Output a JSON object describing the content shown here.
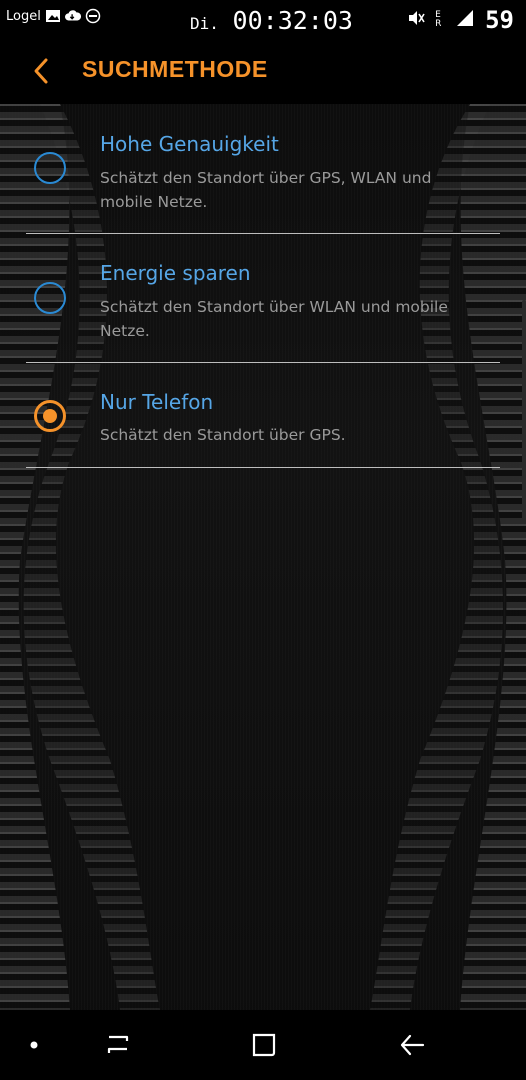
{
  "status_bar": {
    "carrier_label": "Logel",
    "day": "Di.",
    "time": "00:32:03",
    "battery": "59",
    "icons": [
      "image-icon",
      "cloud-sync-icon",
      "do-not-disturb-icon",
      "mute-icon",
      "roaming-signal-icon",
      "signal-icon"
    ],
    "signal_letters": "E R"
  },
  "app_bar": {
    "back_icon": "chevron-left-icon",
    "title": "SUCHMETHODE"
  },
  "options": [
    {
      "title": "Hohe Genauigkeit",
      "description": "Schätzt den Standort über GPS, WLAN und mobile Netze.",
      "selected": false
    },
    {
      "title": "Energie sparen",
      "description": "Schätzt den Standort über WLAN und mobile Netze.",
      "selected": false
    },
    {
      "title": "Nur Telefon",
      "description": "Schätzt den Standort über GPS.",
      "selected": true
    }
  ],
  "nav_bar": {
    "items": [
      "dot-icon",
      "recents-icon",
      "home-icon",
      "back-arrow-icon"
    ]
  },
  "colors": {
    "accent": "#f5922a",
    "option_title": "#56a6e6",
    "radio_unselected": "#2a8ad4",
    "description": "#9a9a9a"
  }
}
